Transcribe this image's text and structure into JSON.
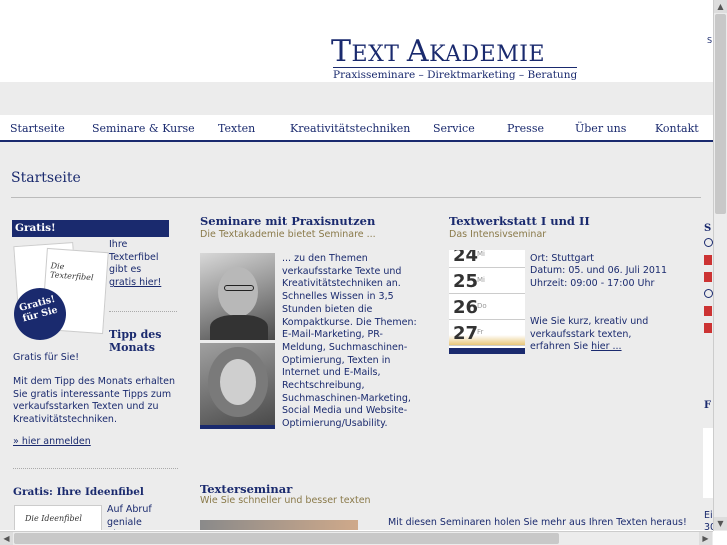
{
  "header": {
    "logo_text_t": "T",
    "logo_text_rest1": "EXT",
    "logo_text_a": "A",
    "logo_text_rest2": "KADEMIE",
    "tagline": "Praxisseminare – Direktmarketing – Beratung",
    "corner_text": "S"
  },
  "nav": [
    "Startseite",
    "Seminare & Kurse",
    "Texten",
    "Kreativitätstechniken",
    "Service",
    "Presse",
    "Über uns",
    "Kontakt"
  ],
  "page_title": "Startseite",
  "left": {
    "gratis_title": "Gratis!",
    "book_cover_title": "Die Texterfibel",
    "badge": "Gratis! für Sie",
    "intro_prefix": "Ihre Texterfibel gibt es ",
    "intro_link": "gratis hier!",
    "tipp_title": "Tipp des Monats",
    "tipp_sub": "Gratis für Sie!",
    "tipp_text": "Mit dem Tipp des Monats erhalten Sie gratis interessante Tipps zum verkaufsstarken Texten und zu Kreativitätstechniken.",
    "tipp_link": "» hier anmelden",
    "ideen_title": "Gratis: Ihre Ideenfibel",
    "ideen_cover_title": "Die Ideenfibel",
    "ideen_text": "Auf Abruf geniale Ideen"
  },
  "middle": {
    "title": "Seminare mit Praxisnutzen",
    "subtitle": "Die Textakademie bietet Seminare ...",
    "text": "... zu den Themen verkaufsstarke Texte und Kreativitätstechniken an. Schnelles Wissen in 3,5 Stunden bieten die Kompaktkurse. Die Themen: E-Mail-Marketing, PR-Meldung, Suchmaschinen-Optimierung, Texten in Internet und E-Mails, Rechtschreibung, Suchmaschinen-Marketing, Social Media und Website-Optimierung/Usability.",
    "texterseminar_title": "Texterseminar",
    "texterseminar_sub": "Wie Sie schneller und besser texten"
  },
  "right": {
    "title": "Textwerkstatt I und II",
    "subtitle": "Das Intensivseminar",
    "calendar": [
      {
        "num": "24",
        "day": "Mi"
      },
      {
        "num": "25",
        "day": "Mi"
      },
      {
        "num": "26",
        "day": "Do"
      },
      {
        "num": "27",
        "day": "Fr"
      }
    ],
    "ort": "Ort: Stuttgart",
    "datum": "Datum: 05. und 06. Juli 2011",
    "uhrzeit": "Uhrzeit: 09:00 - 17:00 Uhr",
    "text_prefix": "Wie Sie kurz, kreativ und verkaufsstark texten, erfahren Sie ",
    "text_link": "hier ...",
    "bottom_banner": "Mit diesen Seminaren holen Sie mehr aus Ihren Texten heraus!"
  },
  "edge": {
    "top_letter": "S",
    "mid_letter": "F",
    "bottom1": "Ei",
    "bottom2": "30"
  },
  "colors": {
    "navy": "#1a2a6e",
    "gold": "#8a7a4a",
    "band": "#ececec"
  }
}
